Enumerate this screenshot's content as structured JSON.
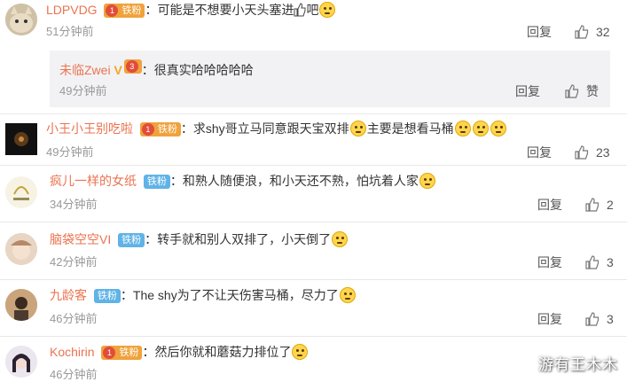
{
  "comments": [
    {
      "user": "LDPVDG",
      "badge": "铁粉",
      "text": "可能是不想要小天头塞进",
      "text_after": "吧",
      "time": "51分钟前",
      "reply": "回复",
      "likes": "32",
      "sub": {
        "user": "未临Zwei",
        "text": "很真实哈哈哈哈哈",
        "time": "49分钟前",
        "reply": "回复",
        "likes": "赞"
      }
    },
    {
      "user": "小王小王别吃啦",
      "badge": "铁粉",
      "text": "求shy哥立马同意跟天宝双排",
      "text_mid": "主要是想看马桶",
      "time": "49分钟前",
      "reply": "回复",
      "likes": "23"
    },
    {
      "user": "疯儿一样的女纸",
      "badge": "铁粉",
      "text": "和熟人随便浪，和小天还不熟，怕坑着人家",
      "time": "34分钟前",
      "reply": "回复",
      "likes": "2"
    },
    {
      "user": "脑袋空空VI",
      "badge": "铁粉",
      "text": "转手就和别人双排了，小天倒了",
      "time": "42分钟前",
      "reply": "回复",
      "likes": "3"
    },
    {
      "user": "九龄客",
      "badge": "铁粉",
      "text": "The shy为了不让天伤害马桶，尽力了",
      "time": "46分钟前",
      "reply": "回复",
      "likes": "3"
    },
    {
      "user": "Kochirin",
      "badge": "铁粉",
      "text": "然后你就和蘑菇力排位了",
      "time": "46分钟前",
      "reply": "回复",
      "likes": "3"
    }
  ],
  "watermark": "游有王木木",
  "colors": {
    "nickname": "#eb7350",
    "fan_badge": "#5fb3e6",
    "gold_badge": "#f0a23c",
    "time": "#999999"
  },
  "icons": [
    "thumbs-up-icon",
    "vip-v-icon",
    "emoji-icon",
    "avatar"
  ]
}
